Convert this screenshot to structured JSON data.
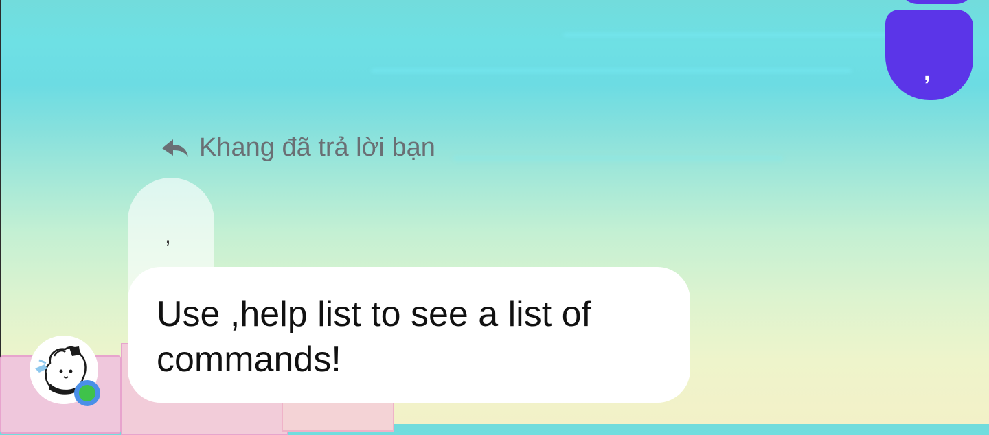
{
  "chat": {
    "outgoing_message": {
      "text": ",",
      "color": "#5b35e8"
    },
    "reply_context": {
      "icon": "reply-arrow-icon",
      "label": "Khang đã trả lời bạn"
    },
    "quoted_message": {
      "text": ","
    },
    "incoming_message": {
      "text": "Use ,help list to see a list of commands!"
    },
    "sender": {
      "avatar": "avatar-cartoon-dog",
      "online_status_color": "#3fc24a"
    }
  }
}
